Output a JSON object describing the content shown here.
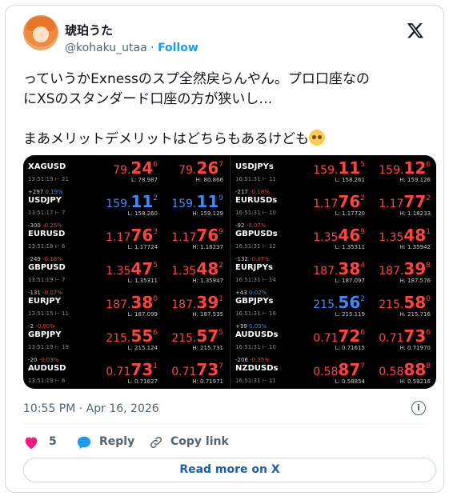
{
  "author": {
    "name": "琥珀うた",
    "handle": "@kohaku_utaa",
    "separator": "·",
    "follow_label": "Follow"
  },
  "tweet": {
    "lines": [
      "っていうかExnessのスプ全然戻らんやん。プロ口座なの",
      "にXSのスタンダード口座の方が狭いし…",
      "まあメリットデメリットはどちらもあるけども"
    ],
    "emoji": "pleading-face-emoji"
  },
  "quotes": {
    "left": [
      {
        "change": "",
        "pct": "",
        "symbol": "XAGUSD",
        "time": "13:51:19 ⊢ 21",
        "bid_main": "79.",
        "bid_big": "24",
        "bid_sup": "6",
        "ask_main": "79.",
        "ask_big": "26",
        "ask_sup": "7",
        "low": "L: 78.987",
        "high": "H: 80.866",
        "dir": "down"
      },
      {
        "change": "+297",
        "pct": "0.19%",
        "symbol": "USDJPY",
        "time": "13:51:17 ⊢ 7",
        "bid_main": "159.",
        "bid_big": "11",
        "bid_sup": "2",
        "ask_main": "159.",
        "ask_big": "11",
        "ask_sup": "9",
        "low": "L: 158.260",
        "high": "H: 159.129",
        "dir": "up"
      },
      {
        "change": "-300",
        "pct": "-0.25%",
        "symbol": "EURUSD",
        "time": "13:51:18 ⊢ 6",
        "bid_main": "1.17",
        "bid_big": "76",
        "bid_sup": "3",
        "ask_main": "1.17",
        "ask_big": "76",
        "ask_sup": "9",
        "low": "L: 1.17724",
        "high": "H: 1.18237",
        "dir": "down"
      },
      {
        "change": "-249",
        "pct": "-0.18%",
        "symbol": "GBPUSD",
        "time": "13:51:19 ⊢ 7",
        "bid_main": "1.35",
        "bid_big": "47",
        "bid_sup": "5",
        "ask_main": "1.35",
        "ask_big": "48",
        "ask_sup": "2",
        "low": "L: 1.35311",
        "high": "H: 1.35947",
        "dir": "down"
      },
      {
        "change": "-131",
        "pct": "-0.07%",
        "symbol": "EURJPY",
        "time": "13:51:15 ⊢ 11",
        "bid_main": "187.",
        "bid_big": "38",
        "bid_sup": "0",
        "ask_main": "187.",
        "ask_big": "39",
        "ask_sup": "1",
        "low": "L: 187.099",
        "high": "H: 187.535",
        "dir": "down"
      },
      {
        "change": "-2",
        "pct": "-0.00%",
        "symbol": "GBPJPY",
        "time": "13:51:19 ⊢ 19",
        "bid_main": "215.",
        "bid_big": "55",
        "bid_sup": "6",
        "ask_main": "215.",
        "ask_big": "57",
        "ask_sup": "5",
        "low": "L: 215.124",
        "high": "H: 215.731",
        "dir": "down"
      },
      {
        "change": "-20",
        "pct": "-0.03%",
        "symbol": "AUDUSD",
        "time": "13:51:19 ⊢ 6",
        "bid_main": "0.71",
        "bid_big": "73",
        "bid_sup": "1",
        "ask_main": "0.71",
        "ask_big": "73",
        "ask_sup": "7",
        "low": "L: 0.71627",
        "high": "H: 0.71971",
        "dir": "down"
      }
    ],
    "right": [
      {
        "change": "",
        "pct": "",
        "symbol": "USDJPYs",
        "time": "16:51:31 ⊢ 11",
        "bid_main": "159.",
        "bid_big": "11",
        "bid_sup": "5",
        "ask_main": "159.",
        "ask_big": "12",
        "ask_sup": "6",
        "low": "L: 158.261",
        "high": "H: 159.126",
        "dir": "down"
      },
      {
        "change": "-217",
        "pct": "-0.18%",
        "symbol": "EURUSDs",
        "time": "16:51:31 ⊢ 10",
        "bid_main": "1.17",
        "bid_big": "76",
        "bid_sup": "2",
        "ask_main": "1.17",
        "ask_big": "77",
        "ask_sup": "2",
        "low": "L: 1.17720",
        "high": "H: 1.18233",
        "dir": "down"
      },
      {
        "change": "-92",
        "pct": "-0.07%",
        "symbol": "GBPUSDs",
        "time": "16:51:31 ⊢ 12",
        "bid_main": "1.35",
        "bid_big": "46",
        "bid_sup": "9",
        "ask_main": "1.35",
        "ask_big": "48",
        "ask_sup": "1",
        "low": "L: 1.35311",
        "high": "H: 1.35942",
        "dir": "down"
      },
      {
        "change": "-132",
        "pct": "-0.07%",
        "symbol": "EURJPYs",
        "time": "16:51:31 ⊢ 14",
        "bid_main": "187.",
        "bid_big": "38",
        "bid_sup": "4",
        "ask_main": "187.",
        "ask_big": "39",
        "ask_sup": "8",
        "low": "L: 187.097",
        "high": "H: 187.576",
        "dir": "down"
      },
      {
        "change": "+43",
        "pct": "0.02%",
        "symbol": "GBPJPYs",
        "time": "16:51:31 ⊢ 18",
        "bid_main": "215.",
        "bid_big": "56",
        "bid_sup": "2",
        "ask_main": "215.",
        "ask_big": "58",
        "ask_sup": "0",
        "low": "L: 215.119",
        "high": "H: 215.716",
        "dir": "mixed"
      },
      {
        "change": "+39",
        "pct": "0.05%",
        "symbol": "AUDUSDs",
        "time": "16:51:31 ⊢ 10",
        "bid_main": "0.71",
        "bid_big": "72",
        "bid_sup": "6",
        "ask_main": "0.71",
        "ask_big": "73",
        "ask_sup": "6",
        "low": "L: 0.71615",
        "high": "H: 0.71970",
        "dir": "down"
      },
      {
        "change": "-206",
        "pct": "-0.35%",
        "symbol": "NZDUSDs",
        "time": "16:51:31 ⊢ 11",
        "bid_main": "0.58",
        "bid_big": "87",
        "bid_sup": "7",
        "ask_main": "0.58",
        "ask_big": "88",
        "ask_sup": "8",
        "low": "L: 0.58854",
        "high": "H: 0.59216",
        "dir": "down"
      }
    ]
  },
  "timestamp": "10:55 PM · Apr 16, 2026",
  "actions": {
    "like_count": "5",
    "reply_label": "Reply",
    "copy_label": "Copy link"
  },
  "read_more_label": "Read more on X",
  "colors": {
    "accent": "#1d9bf0",
    "like": "#f91880",
    "reply": "#1d9bf0",
    "price_down": "#ff453a",
    "price_up": "#3b8bff"
  }
}
